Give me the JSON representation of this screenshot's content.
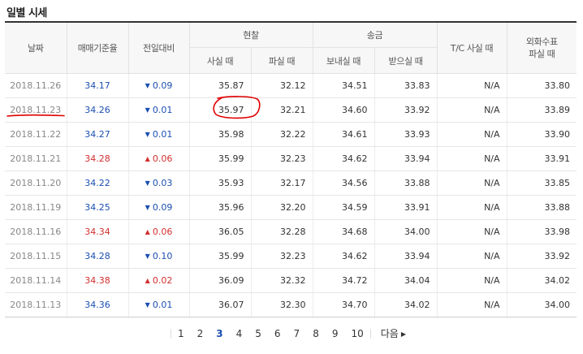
{
  "page": {
    "title": "일별 시세"
  },
  "table": {
    "headers": {
      "date": "날짜",
      "base_rate": "매매기준율",
      "change": "전일대비",
      "cash": "현찰",
      "cash_buy": "사실 때",
      "cash_sell": "파실 때",
      "transfer": "송금",
      "transfer_send": "보내실 때",
      "transfer_receive": "받으실 때",
      "tc_buy": "T/C 사실 때",
      "fx_check": "외화수표\n파실 때"
    },
    "rows": [
      {
        "date": "2018.11.26",
        "base": "34.17",
        "dir": "down",
        "diff": "0.09",
        "cash_buy": "35.87",
        "cash_sell": "32.12",
        "send": "34.51",
        "receive": "33.83",
        "tc": "N/A",
        "fx": "33.80"
      },
      {
        "date": "2018.11.23",
        "base": "34.26",
        "dir": "down",
        "diff": "0.01",
        "cash_buy": "35.97",
        "cash_sell": "32.21",
        "send": "34.60",
        "receive": "33.92",
        "tc": "N/A",
        "fx": "33.89"
      },
      {
        "date": "2018.11.22",
        "base": "34.27",
        "dir": "down",
        "diff": "0.01",
        "cash_buy": "35.98",
        "cash_sell": "32.22",
        "send": "34.61",
        "receive": "33.93",
        "tc": "N/A",
        "fx": "33.90"
      },
      {
        "date": "2018.11.21",
        "base": "34.28",
        "dir": "up",
        "diff": "0.06",
        "cash_buy": "35.99",
        "cash_sell": "32.23",
        "send": "34.62",
        "receive": "33.94",
        "tc": "N/A",
        "fx": "33.91"
      },
      {
        "date": "2018.11.20",
        "base": "34.22",
        "dir": "down",
        "diff": "0.03",
        "cash_buy": "35.93",
        "cash_sell": "32.17",
        "send": "34.56",
        "receive": "33.88",
        "tc": "N/A",
        "fx": "33.85"
      },
      {
        "date": "2018.11.19",
        "base": "34.25",
        "dir": "down",
        "diff": "0.09",
        "cash_buy": "35.96",
        "cash_sell": "32.20",
        "send": "34.59",
        "receive": "33.91",
        "tc": "N/A",
        "fx": "33.88"
      },
      {
        "date": "2018.11.16",
        "base": "34.34",
        "dir": "up",
        "diff": "0.06",
        "cash_buy": "36.05",
        "cash_sell": "32.28",
        "send": "34.68",
        "receive": "34.00",
        "tc": "N/A",
        "fx": "33.98"
      },
      {
        "date": "2018.11.15",
        "base": "34.28",
        "dir": "down",
        "diff": "0.10",
        "cash_buy": "35.99",
        "cash_sell": "32.23",
        "send": "34.62",
        "receive": "33.94",
        "tc": "N/A",
        "fx": "33.92"
      },
      {
        "date": "2018.11.14",
        "base": "34.38",
        "dir": "up",
        "diff": "0.02",
        "cash_buy": "36.09",
        "cash_sell": "32.32",
        "send": "34.72",
        "receive": "34.04",
        "tc": "N/A",
        "fx": "34.02"
      },
      {
        "date": "2018.11.13",
        "base": "34.36",
        "dir": "down",
        "diff": "0.01",
        "cash_buy": "36.07",
        "cash_sell": "32.30",
        "send": "34.70",
        "receive": "34.02",
        "tc": "N/A",
        "fx": "34.00"
      }
    ]
  },
  "pagination": {
    "pages": [
      "1",
      "2",
      "3",
      "4",
      "5",
      "6",
      "7",
      "8",
      "9",
      "10"
    ],
    "current": "3",
    "next_label": "다음"
  },
  "colors": {
    "up": "#d32f2f",
    "down": "#1b4fb0",
    "annotation": "#e00000"
  },
  "icons": {
    "up": "triangle-up-icon",
    "down": "triangle-down-icon",
    "next": "chevron-right-icon"
  }
}
